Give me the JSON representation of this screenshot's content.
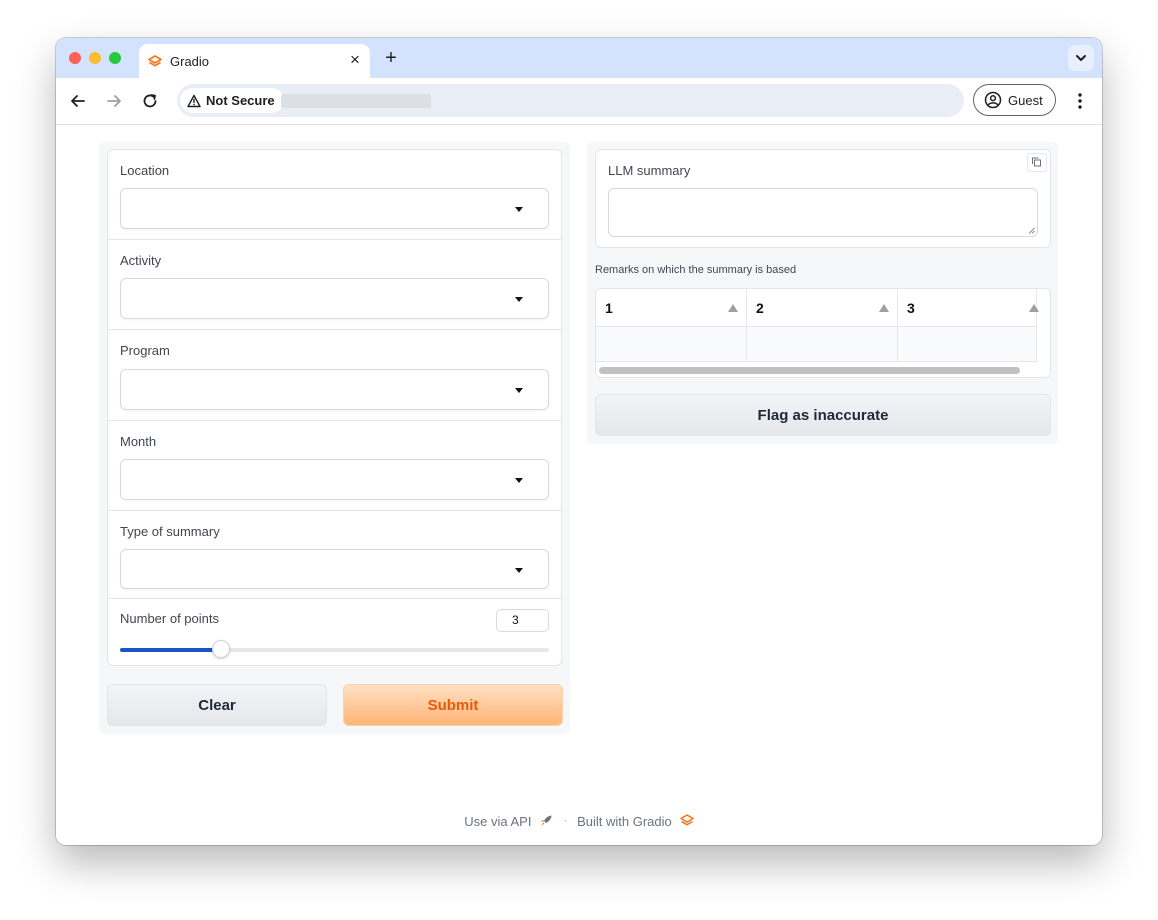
{
  "browser": {
    "tab_title": "Gradio",
    "new_tab_glyph": "+",
    "close_glyph": "×",
    "security_label": "Not Secure",
    "profile_label": "Guest",
    "icons": {
      "tab_favicon": "gradio-logo-icon",
      "back": "arrow-left-icon",
      "forward": "arrow-right-icon",
      "reload": "reload-icon",
      "warning": "warning-triangle-icon",
      "profile": "account-circle-icon",
      "menu": "kebab-menu-icon",
      "tab_search": "chevron-down-icon"
    },
    "colors": {
      "tab_strip": "#d3e3fd",
      "omnibox": "#e9eef6"
    }
  },
  "form": {
    "fields": [
      {
        "label": "Location",
        "value": ""
      },
      {
        "label": "Activity",
        "value": ""
      },
      {
        "label": "Program",
        "value": ""
      },
      {
        "label": "Month",
        "value": ""
      },
      {
        "label": "Type of summary",
        "value": ""
      }
    ],
    "points": {
      "label": "Number of points",
      "value": "3",
      "fraction": 0.235
    },
    "clear_label": "Clear",
    "submit_label": "Submit"
  },
  "output": {
    "summary_label": "LLM summary",
    "summary_value": "",
    "remarks_label": "Remarks on which the summary is based",
    "table": {
      "headers": [
        "1",
        "2",
        "3"
      ],
      "rows": [
        [
          "",
          "",
          ""
        ]
      ]
    },
    "flag_label": "Flag as inaccurate"
  },
  "footer": {
    "api_label": "Use via API",
    "separator": "·",
    "built_label": "Built with Gradio"
  },
  "colors": {
    "accent_orange": "#ea580c",
    "submit_bg": "#ffb476",
    "slider_fill": "#1b56c9"
  }
}
